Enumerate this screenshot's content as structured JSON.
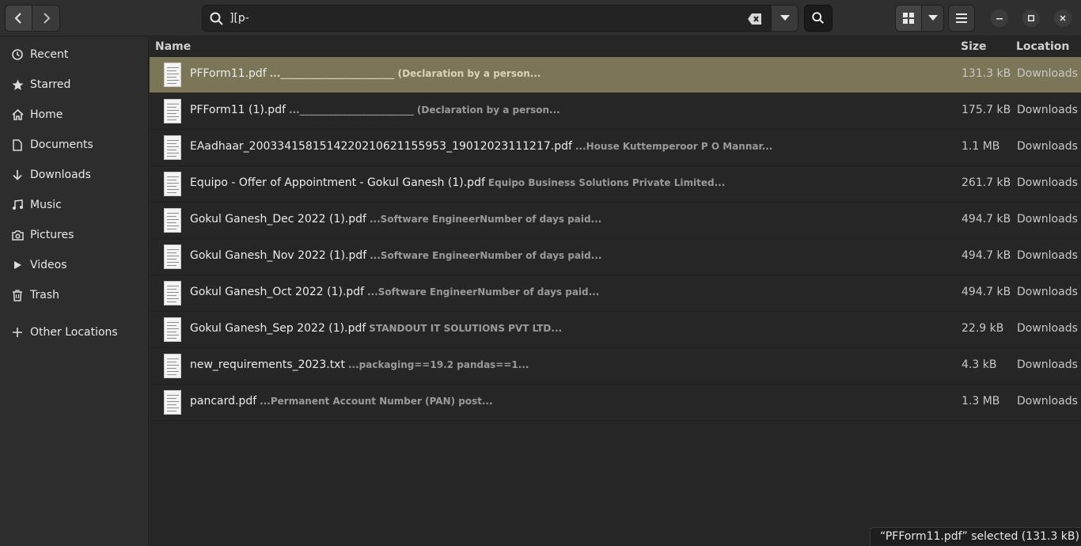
{
  "header": {
    "search_query": "][p-",
    "back_icon": "chevron-left-icon",
    "forward_icon": "chevron-right-icon"
  },
  "sidebar": {
    "items": [
      {
        "label": "Recent",
        "icon": "clock-icon"
      },
      {
        "label": "Starred",
        "icon": "star-icon"
      },
      {
        "label": "Home",
        "icon": "home-icon"
      },
      {
        "label": "Documents",
        "icon": "document-icon"
      },
      {
        "label": "Downloads",
        "icon": "download-icon"
      },
      {
        "label": "Music",
        "icon": "music-icon"
      },
      {
        "label": "Pictures",
        "icon": "camera-icon"
      },
      {
        "label": "Videos",
        "icon": "video-icon"
      },
      {
        "label": "Trash",
        "icon": "trash-icon"
      }
    ],
    "other_locations": "Other Locations"
  },
  "columns": {
    "name": "Name",
    "size": "Size",
    "location": "Location"
  },
  "files": [
    {
      "name": "PFForm11.pdf",
      "snippet": "...________________________ (Declaration by a person...",
      "size": "131.3 kB",
      "location": "Downloads",
      "selected": true
    },
    {
      "name": "PFForm11 (1).pdf",
      "snippet": "...________________________ (Declaration by a person...",
      "size": "175.7 kB",
      "location": "Downloads",
      "selected": false
    },
    {
      "name": "EAadhaar_2003341581514220210621155953_19012023111217.pdf",
      "snippet": "...House Kuttemperoor P O Mannar...",
      "size": "1.1 MB",
      "location": "Downloads",
      "selected": false
    },
    {
      "name": "Equipo - Offer of Appointment - Gokul Ganesh (1).pdf",
      "snippet": "Equipo Business Solutions Private Limited...",
      "size": "261.7 kB",
      "location": "Downloads",
      "selected": false
    },
    {
      "name": "Gokul Ganesh_Dec 2022 (1).pdf",
      "snippet": "...Software EngineerNumber of days paid...",
      "size": "494.7 kB",
      "location": "Downloads",
      "selected": false
    },
    {
      "name": "Gokul Ganesh_Nov 2022 (1).pdf",
      "snippet": "...Software EngineerNumber of days paid...",
      "size": "494.7 kB",
      "location": "Downloads",
      "selected": false
    },
    {
      "name": "Gokul Ganesh_Oct 2022 (1).pdf",
      "snippet": "...Software EngineerNumber of days paid...",
      "size": "494.7 kB",
      "location": "Downloads",
      "selected": false
    },
    {
      "name": "Gokul Ganesh_Sep 2022 (1).pdf",
      "snippet": "STANDOUT IT SOLUTIONS PVT LTD...",
      "size": "22.9 kB",
      "location": "Downloads",
      "selected": false
    },
    {
      "name": "new_requirements_2023.txt",
      "snippet": "...packaging==19.2 pandas==1...",
      "size": "4.3 kB",
      "location": "Downloads",
      "selected": false
    },
    {
      "name": "pancard.pdf",
      "snippet": "...Permanent Account Number (PAN) post...",
      "size": "1.3 MB",
      "location": "Downloads",
      "selected": false
    }
  ],
  "status": {
    "text": "“PFForm11.pdf” selected  (131.3 kB)"
  },
  "colors": {
    "selected_row": "#7a7657",
    "background": "#262626",
    "sidebar": "#2d2d2d"
  }
}
